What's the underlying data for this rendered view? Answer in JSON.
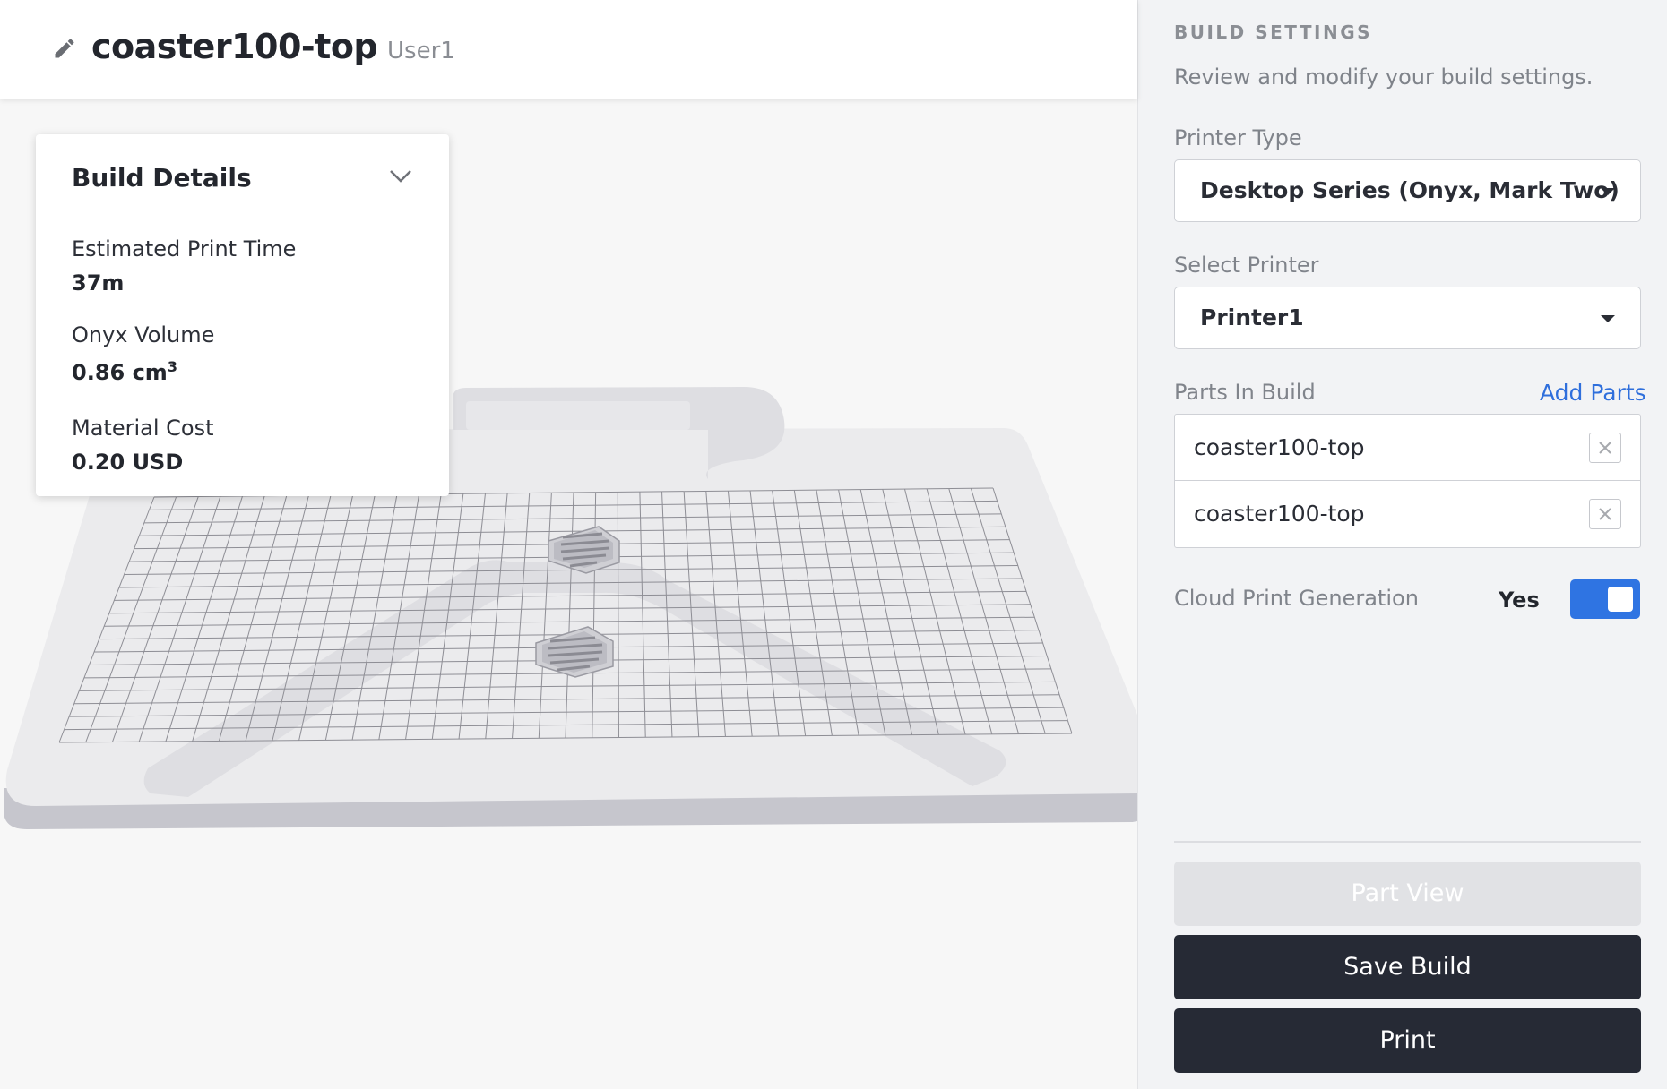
{
  "header": {
    "title": "coaster100-top",
    "user": "User1",
    "edit_icon": "pencil-icon"
  },
  "build_details": {
    "title": "Build Details",
    "toggle_icon": "chevron-down-icon",
    "print_time_label": "Estimated Print Time",
    "print_time_value": "37m",
    "volume_label": "Onyx Volume",
    "volume_value": "0.86 cm",
    "volume_unit_exponent": "3",
    "cost_label": "Material Cost",
    "cost_value": "0.20 USD"
  },
  "settings": {
    "heading": "BUILD SETTINGS",
    "subtitle": "Review and modify your build settings.",
    "printer_type_label": "Printer Type",
    "printer_type_value": "Desktop Series (Onyx, Mark Two)",
    "select_printer_label": "Select Printer",
    "select_printer_value": "Printer1",
    "parts_label": "Parts In Build",
    "add_parts": "Add Parts",
    "parts": [
      {
        "name": "coaster100-top"
      },
      {
        "name": "coaster100-top"
      }
    ],
    "cloud_label": "Cloud Print Generation",
    "cloud_value": "Yes",
    "cloud_enabled": true
  },
  "actions": {
    "part_view": "Part View",
    "save_build": "Save Build",
    "print": "Print"
  },
  "colors": {
    "accent": "#2f74e2",
    "link": "#2f6fdc",
    "dark_button": "#262a35",
    "disabled_button": "#e1e2e5"
  }
}
